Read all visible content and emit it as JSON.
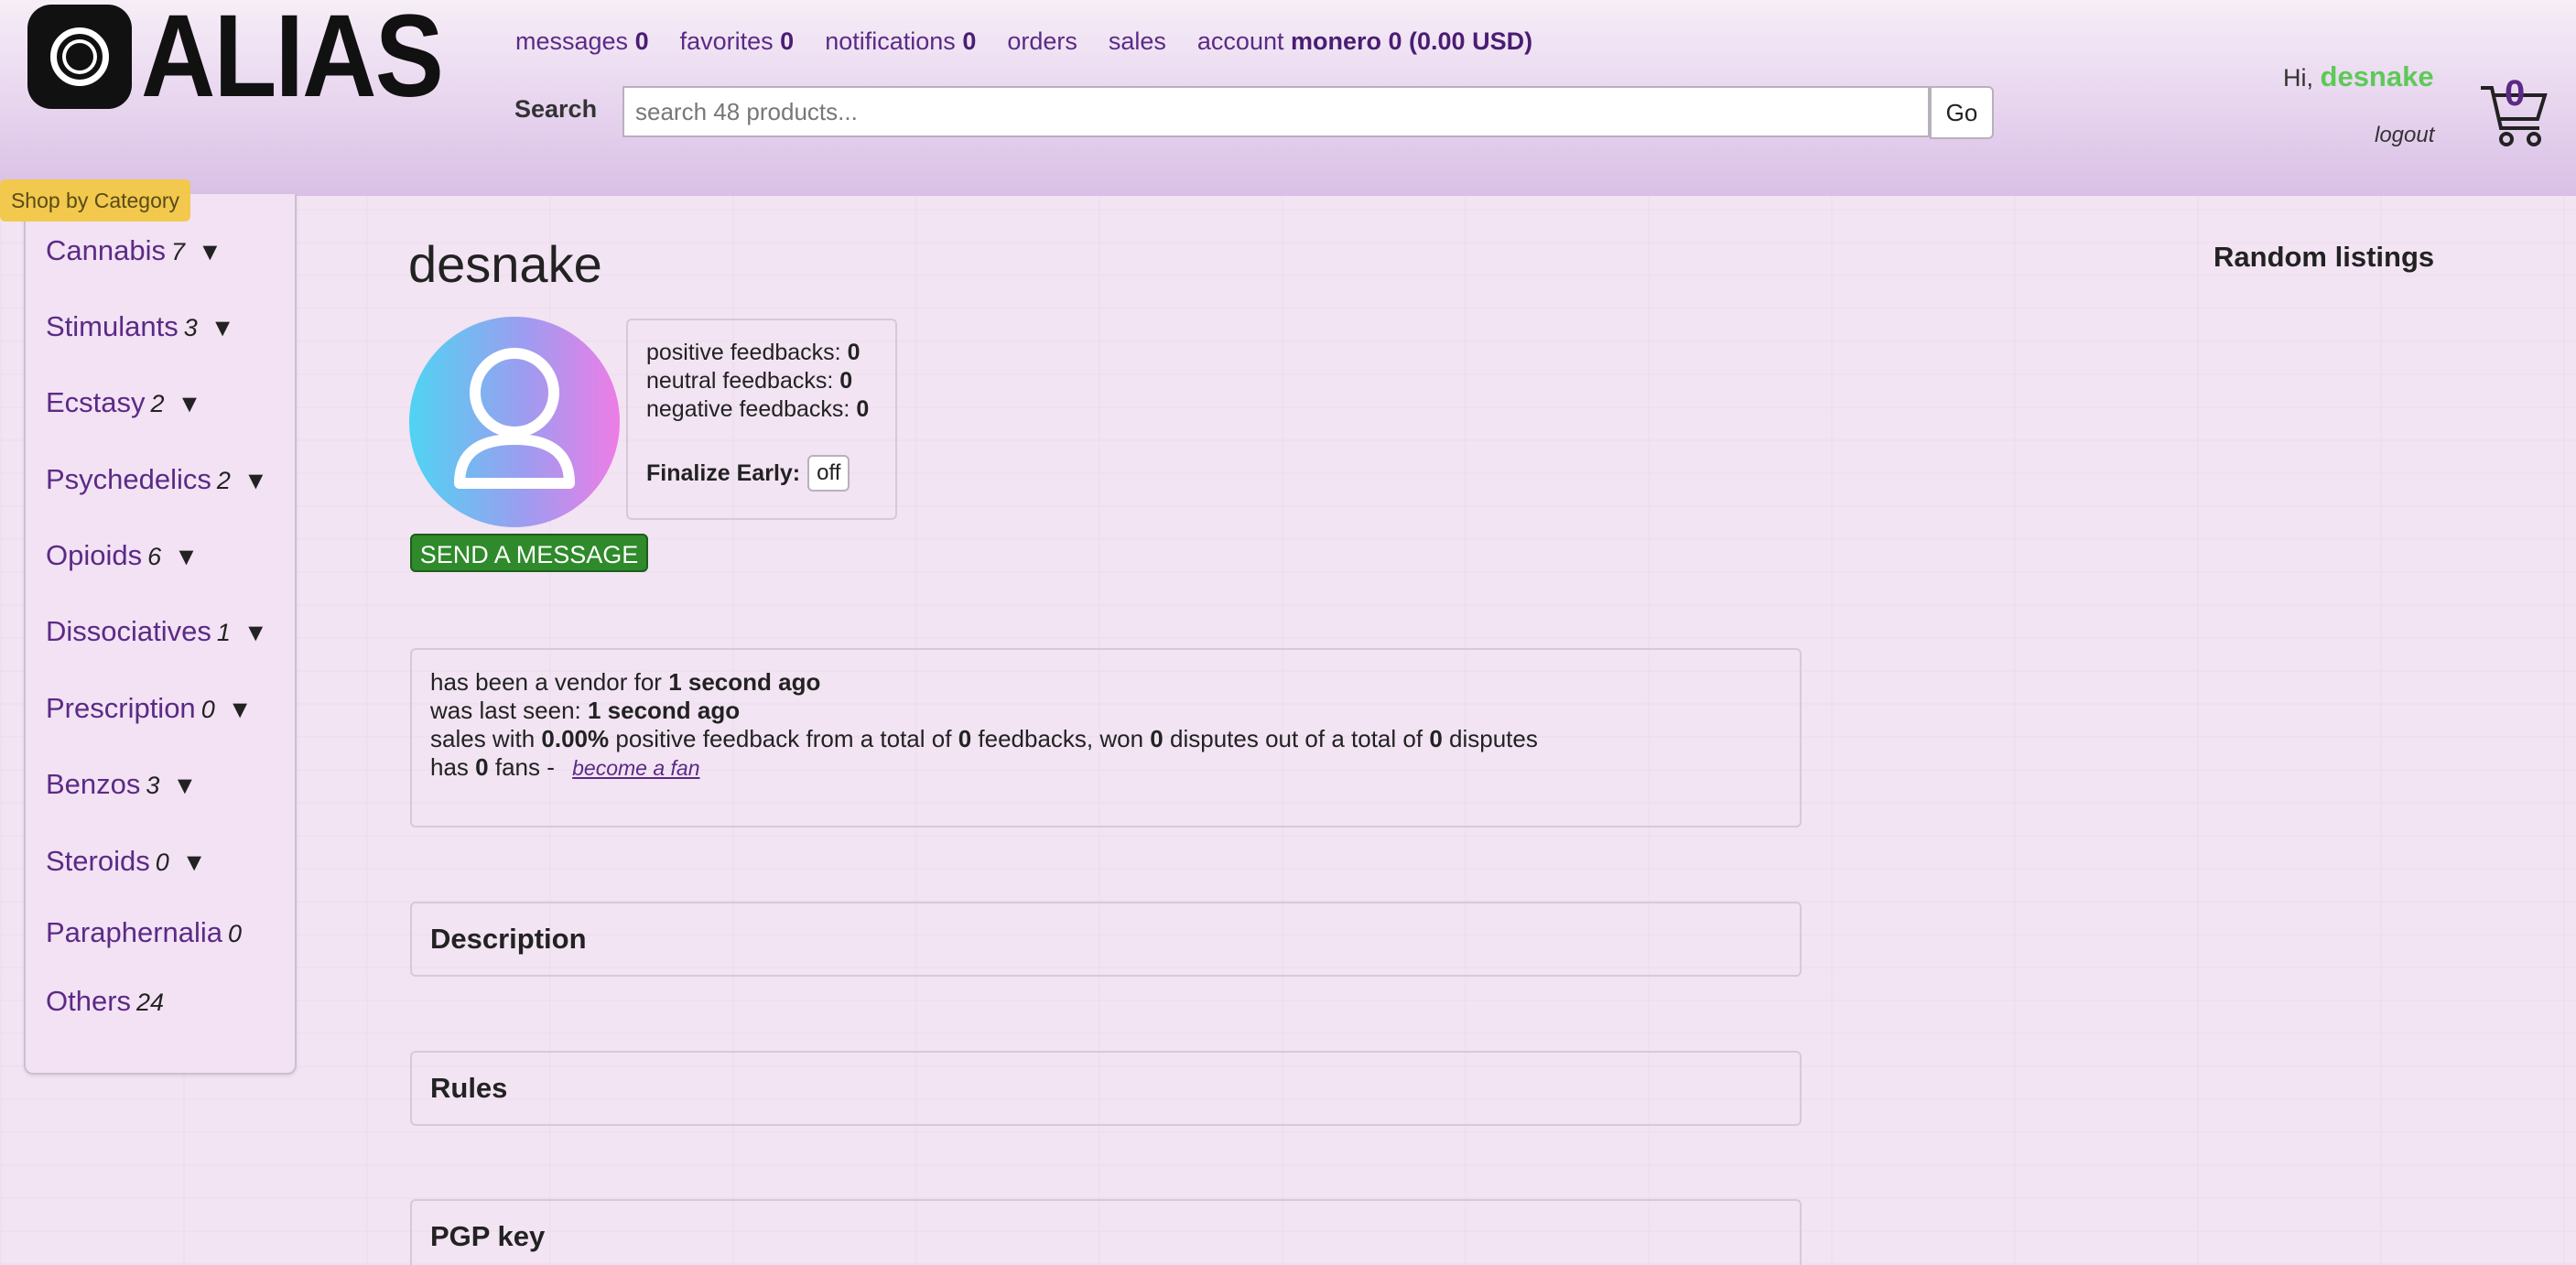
{
  "brand": {
    "name": "ALIAS"
  },
  "nav": {
    "messages_label": "messages",
    "messages_count": "0",
    "favorites_label": "favorites",
    "favorites_count": "0",
    "notifications_label": "notifications",
    "notifications_count": "0",
    "orders_label": "orders",
    "sales_label": "sales",
    "account_label": "account",
    "account_balance": "monero 0 (0.00 USD)"
  },
  "search": {
    "label": "Search",
    "placeholder": "search 48 products...",
    "go_label": "Go"
  },
  "user": {
    "greeting": "Hi,",
    "username": "desnake",
    "logout_label": "logout",
    "cart_count": "0"
  },
  "sidebar": {
    "title": "Shop by Category",
    "items": [
      {
        "label": "Cannabis",
        "count": "7",
        "arrow": "▼"
      },
      {
        "label": "Stimulants",
        "count": "3",
        "arrow": "▼"
      },
      {
        "label": "Ecstasy",
        "count": "2",
        "arrow": "▼"
      },
      {
        "label": "Psychedelics",
        "count": "2",
        "arrow": "▼"
      },
      {
        "label": "Opioids",
        "count": "6",
        "arrow": "▼"
      },
      {
        "label": "Dissociatives",
        "count": "1",
        "arrow": "▼"
      },
      {
        "label": "Prescription",
        "count": "0",
        "arrow": "▼"
      },
      {
        "label": "Benzos",
        "count": "3",
        "arrow": "▼"
      },
      {
        "label": "Steroids",
        "count": "0",
        "arrow": "▼"
      },
      {
        "label": "Paraphernalia",
        "count": "0"
      },
      {
        "label": "Others",
        "count": "24"
      }
    ]
  },
  "profile": {
    "name": "desnake",
    "positive_label": "positive feedbacks:",
    "positive_value": "0",
    "neutral_label": "neutral feedbacks:",
    "neutral_value": "0",
    "negative_label": "negative feedbacks:",
    "negative_value": "0",
    "finalize_label": "Finalize Early:",
    "finalize_value": "off",
    "send_message_label": "SEND A MESSAGE"
  },
  "info": {
    "vendor_prefix": "has been a vendor for",
    "vendor_value": "1 second ago",
    "seen_prefix": "was last seen:",
    "seen_value": "1 second ago",
    "sales_p1": "sales with",
    "sales_pct": "0.00%",
    "sales_p2": "positive feedback from a total of",
    "sales_total": "0",
    "sales_p3": "feedbacks, won",
    "sales_won": "0",
    "sales_p4": "disputes out of a total of",
    "sales_disputes": "0",
    "sales_p5": "disputes",
    "fans_prefix": "has",
    "fans_value": "0",
    "fans_suffix": "fans -",
    "become_fan_label": "become a fan"
  },
  "sections": {
    "description": "Description",
    "rules": "Rules",
    "pgp": "PGP key"
  },
  "random_listings": {
    "title": "Random listings"
  },
  "colors": {
    "accent": "#5b2a86",
    "username": "#5ec957",
    "send_button": "#2e8a2a",
    "category_tag": "#f2c94c"
  }
}
